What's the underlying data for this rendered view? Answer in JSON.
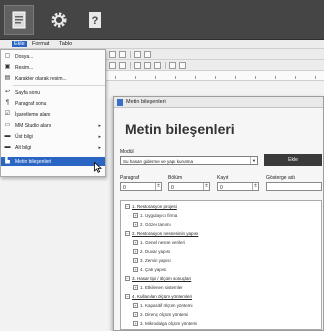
{
  "topbar": {
    "buttons": [
      {
        "name": "document-icon"
      },
      {
        "name": "gear-icon"
      },
      {
        "name": "help-icon",
        "label": "?"
      }
    ]
  },
  "menubar": {
    "items": [
      "Ekle",
      "Format",
      "Tablo"
    ]
  },
  "insert_menu": {
    "items": [
      {
        "label": "Dosya...",
        "icon": "file-icon",
        "glyph": "▢",
        "submenu": false
      },
      {
        "label": "Resim...",
        "icon": "image-icon",
        "glyph": "▣",
        "submenu": false
      },
      {
        "label": "Karakter olarak resim...",
        "icon": "image-char-icon",
        "glyph": "▤",
        "submenu": false
      },
      {
        "label": "Sayfa sonu",
        "icon": "page-break-icon",
        "glyph": "↩",
        "submenu": false
      },
      {
        "label": "Paragraf sonu",
        "icon": "paragraph-break-icon",
        "glyph": "¶",
        "submenu": false
      },
      {
        "label": "İşaretleme alanı",
        "icon": "checkbox-icon",
        "glyph": "☑",
        "submenu": false
      },
      {
        "label": "MM Studio alanı",
        "icon": "field-icon",
        "glyph": "▭",
        "submenu": true
      },
      {
        "label": "Üst bilgi",
        "icon": "header-icon",
        "glyph": "▬",
        "submenu": true
      },
      {
        "label": "Alt bilgi",
        "icon": "footer-icon",
        "glyph": "▬",
        "submenu": true
      },
      {
        "label": "Metin bileşenleri",
        "icon": "text-component-icon",
        "glyph": "▙",
        "submenu": false,
        "highlighted": true
      }
    ]
  },
  "dialog": {
    "title": "Metin bileşenleri",
    "heading": "Metin bileşenleri",
    "model_label": "Modül",
    "model_value": "Su hasarı giderme ve yapı kurutma",
    "add_button": "Ekle",
    "paragraph_label": "Paragraf",
    "paragraph_value": "0",
    "section_label": "Bölüm",
    "section_value": "0",
    "record_label": "Kayıt",
    "record_value": "0",
    "display_name_label": "Gösterge adı",
    "display_name_value": "",
    "tree": [
      {
        "level": 0,
        "label": "1. Restorasyon projesi",
        "toggle": "−"
      },
      {
        "level": 1,
        "label": "1. Uygulayıcı firma",
        "toggle": "+"
      },
      {
        "level": 1,
        "label": "2. Gözeı tanımı",
        "toggle": "+"
      },
      {
        "level": 0,
        "label": "2. Restorasyon nesnesinin yapısı",
        "toggle": "−"
      },
      {
        "level": 1,
        "label": "1. Genel nesne verileri",
        "toggle": "+"
      },
      {
        "level": 1,
        "label": "2. Duvar yapısı",
        "toggle": "+"
      },
      {
        "level": 1,
        "label": "3. Zemin yapısı",
        "toggle": "+"
      },
      {
        "level": 1,
        "label": "4. Çatı yapısı",
        "toggle": "+"
      },
      {
        "level": 0,
        "label": "3. Hasar tipi / ölçüm sonuçları",
        "toggle": "−"
      },
      {
        "level": 1,
        "label": "1. Etkilenen sistemler",
        "toggle": "+"
      },
      {
        "level": 0,
        "label": "4. Kullanılan ölçüm yöntemleri",
        "toggle": "−"
      },
      {
        "level": 1,
        "label": "1. Kapasitif ölçüm yöntemi",
        "toggle": "+"
      },
      {
        "level": 1,
        "label": "2. Direnç ölçüm yöntemi",
        "toggle": "+"
      },
      {
        "level": 1,
        "label": "3. Mikrodalga ölçüm yöntemi",
        "toggle": "+"
      }
    ]
  },
  "colors": {
    "topbar": "#454545",
    "highlight": "#2b65c4",
    "button_dark": "#3a3a3a"
  }
}
